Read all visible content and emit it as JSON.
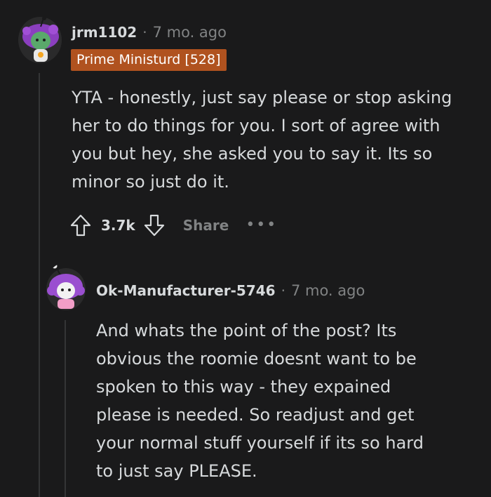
{
  "comment": {
    "username": "jrm1102",
    "separator": "·",
    "time": "7 mo. ago",
    "flair": "Prime Ministurd [528]",
    "lines": [
      "YTA - honestly, just say please or stop asking",
      "her to do things for you. I sort of agree with",
      "you but hey, she asked you to say it. Its so",
      "minor so just do it."
    ],
    "score": "3.7k",
    "share_label": "Share",
    "more_label": "•••",
    "avatar_icon": "snoo-avatar-icon",
    "flair_color": "#b0521f"
  },
  "reply": {
    "username": "Ok-Manufacturer-5746",
    "separator": "·",
    "time": "7 mo. ago",
    "lines": [
      "And whats the point of the post? Its",
      "obvious the roomie doesnt want to be",
      "spoken to this way - they expained",
      "please is needed. So readjust and get",
      "your normal stuff yourself if its so hard",
      "to just say PLEASE."
    ],
    "avatar_icon": "snoo-avatar-icon"
  }
}
